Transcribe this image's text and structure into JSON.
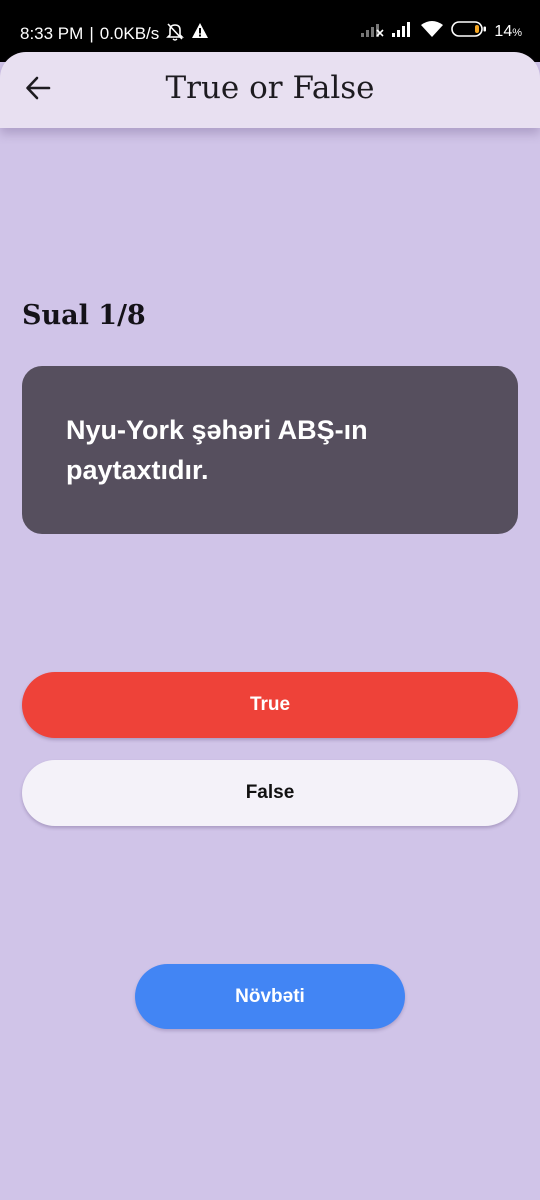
{
  "status_bar": {
    "time": "8:33 PM",
    "separator": "|",
    "network_speed": "0.0KB/s",
    "battery_percent": "14",
    "battery_unit": "%",
    "icons": [
      "mute-bell-icon",
      "warning-icon",
      "signal-no-data-icon",
      "signal-icon",
      "wifi-icon",
      "battery-icon"
    ]
  },
  "app_bar": {
    "title": "True or False",
    "back_icon": "arrow-left-icon"
  },
  "quiz": {
    "counter": "Sual 1/8",
    "question": "Nyu-York şəhəri ABŞ-ın paytaxtıdır.",
    "answers": {
      "true_label": "True",
      "false_label": "False"
    },
    "next_label": "Növbəti"
  },
  "colors": {
    "background": "#d0c4e8",
    "app_bar": "#e8e0f1",
    "question_card": "#564f5e",
    "true_button": "#ee4239",
    "false_button": "#f4f2f9",
    "next_button": "#4285f4"
  }
}
